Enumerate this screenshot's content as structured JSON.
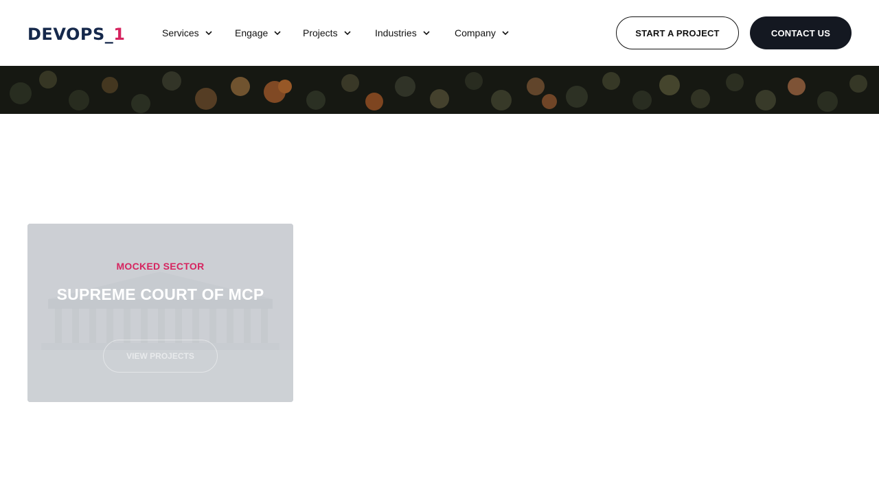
{
  "brand": {
    "main": "DEVOPS_",
    "accent": "1",
    "color_main": "#15284b",
    "color_accent": "#d6245f"
  },
  "nav": {
    "items": [
      {
        "label": "Services"
      },
      {
        "label": "Engage"
      },
      {
        "label": "Projects"
      },
      {
        "label": "Industries"
      },
      {
        "label": "Company"
      }
    ],
    "chevron_icon": "chevron-down-icon"
  },
  "actions": {
    "start_project": "START A PROJECT",
    "contact": "CONTACT US"
  },
  "hero": {
    "image": "autumn-forest-aerial"
  },
  "project_card": {
    "sector": "MOCKED SECTOR",
    "title": "SUPREME COURT OF MCP",
    "button": "VIEW PROJECTS",
    "image": "courthouse-building"
  },
  "colors": {
    "accent": "#d6245f",
    "dark_button": "#141821"
  }
}
